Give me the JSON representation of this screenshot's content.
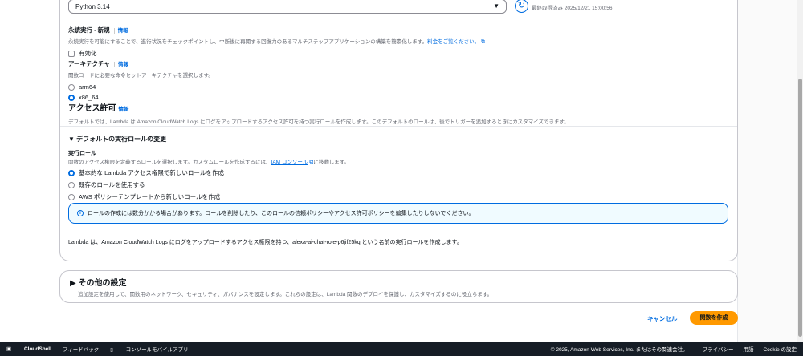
{
  "runtime": {
    "selected": "Python 3.14",
    "last_fetched": "最終取得済み 2025/12/21 15:00:56"
  },
  "durable": {
    "label": "永続実行 - 新規",
    "info": "情報",
    "desc": "永続実行を可能にすることで、進行状況をチェックポイントし、中断後に再開する回復力のあるマルチステップアプリケーションの構築を簡素化します。",
    "link": "料金をご覧ください。",
    "checkbox": "有効化"
  },
  "arch": {
    "label": "アーキテクチャ",
    "info": "情報",
    "desc": "関数コードに必要な命令セットアーキテクチャを選択します。",
    "options": [
      "arm64",
      "x86_64"
    ]
  },
  "permissions": {
    "title": "アクセス許可",
    "info": "情報",
    "desc": "デフォルトでは、Lambda は Amazon CloudWatch Logs にログをアップロードするアクセス許可を持つ実行ロールを作成します。このデフォルトのロールは、後でトリガーを追加するときにカスタマイズできます。"
  },
  "role": {
    "expander": "デフォルトの実行ロールの変更",
    "label": "実行ロール",
    "desc_pre": "関数のアクセス権限を定義するロールを選択します。カスタムロールを作成するには、",
    "desc_link": "IAM コンソール",
    "desc_post": "に移動します。",
    "options": [
      "基本的な Lambda アクセス権限で新しいロールを作成",
      "既存のロールを使用する",
      "AWS ポリシーテンプレートから新しいロールを作成"
    ],
    "alert": "ロールの作成には数分かかる場合があります。ロールを削除したり、このロールの信頼ポリシーやアクセス許可ポリシーを編集したりしないでください。",
    "summary": "Lambda は、Amazon CloudWatch Logs にログをアップロードするアクセス権限を持つ、alexa-ai-chat-role-p6jif25kq という名前の実行ロールを作成します。"
  },
  "other": {
    "title": "その他の設定",
    "desc": "追加設定を使用して、関数用のネットワーク、セキュリティ、ガバナンスを設定します。これらの設定は、Lambda 関数のデプロイを保護し、カスタマイズするのに役立ちます。"
  },
  "actions": {
    "cancel": "キャンセル",
    "create": "関数を作成"
  },
  "footer": {
    "cloudshell": "CloudShell",
    "feedback": "フィードバック",
    "mobile": "コンソールモバイルアプリ",
    "copyright": "© 2025, Amazon Web Services, Inc. またはその関連会社。",
    "privacy": "プライバシー",
    "terms": "用語",
    "cookie": "Cookie の設定"
  }
}
